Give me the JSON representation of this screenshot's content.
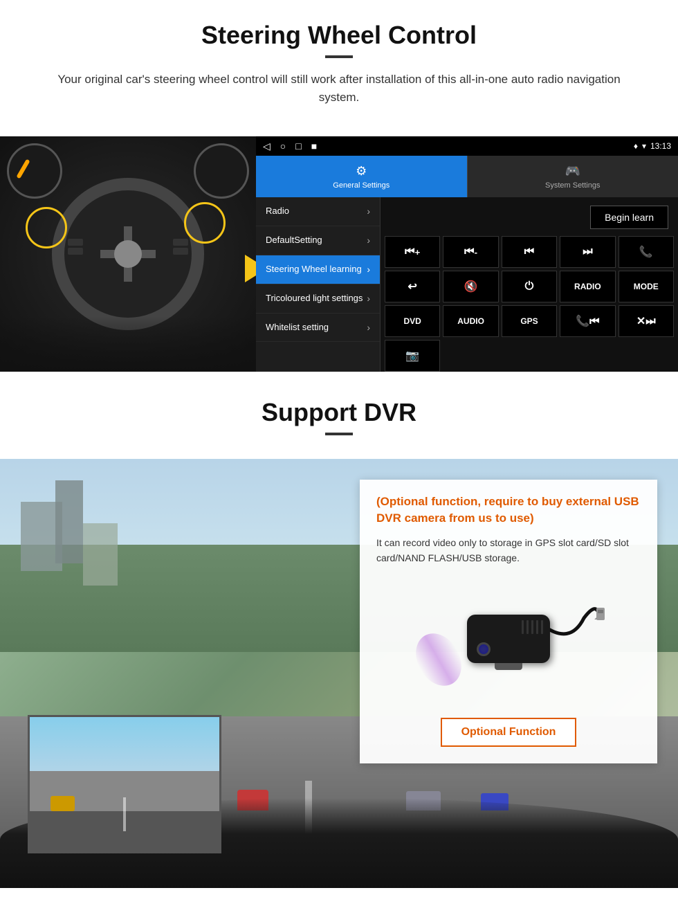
{
  "section1": {
    "title": "Steering Wheel Control",
    "subtitle": "Your original car's steering wheel control will still work after installation of this all-in-one auto radio navigation system.",
    "statusBar": {
      "navIcons": [
        "◁",
        "○",
        "□",
        "■"
      ],
      "time": "13:13",
      "signalIcons": "♦ ▾"
    },
    "tabs": [
      {
        "label": "General Settings",
        "icon": "⚙",
        "active": true
      },
      {
        "label": "System Settings",
        "icon": "🎮",
        "active": false
      }
    ],
    "menuItems": [
      {
        "label": "Radio",
        "active": false
      },
      {
        "label": "DefaultSetting",
        "active": false
      },
      {
        "label": "Steering Wheel learning",
        "active": true
      },
      {
        "label": "Tricoloured light settings",
        "active": false
      },
      {
        "label": "Whitelist setting",
        "active": false
      }
    ],
    "beginLearnBtn": "Begin learn",
    "controlButtons": {
      "row1": [
        "⏮+",
        "⏮-",
        "⏮⏮",
        "⏭⏭",
        "📞"
      ],
      "row2": [
        "↩",
        "🔇×",
        "⏻",
        "RADIO",
        "MODE"
      ],
      "row3": [
        "DVD",
        "AUDIO",
        "GPS",
        "📞⏮",
        "✕⏭"
      ],
      "row4": [
        "📷"
      ]
    }
  },
  "section2": {
    "title": "Support DVR",
    "optionalTitle": "(Optional function, require to buy external USB DVR camera from us to use)",
    "description": "It can record video only to storage in GPS slot card/SD slot card/NAND FLASH/USB storage.",
    "optionalFunctionBtn": "Optional Function"
  }
}
